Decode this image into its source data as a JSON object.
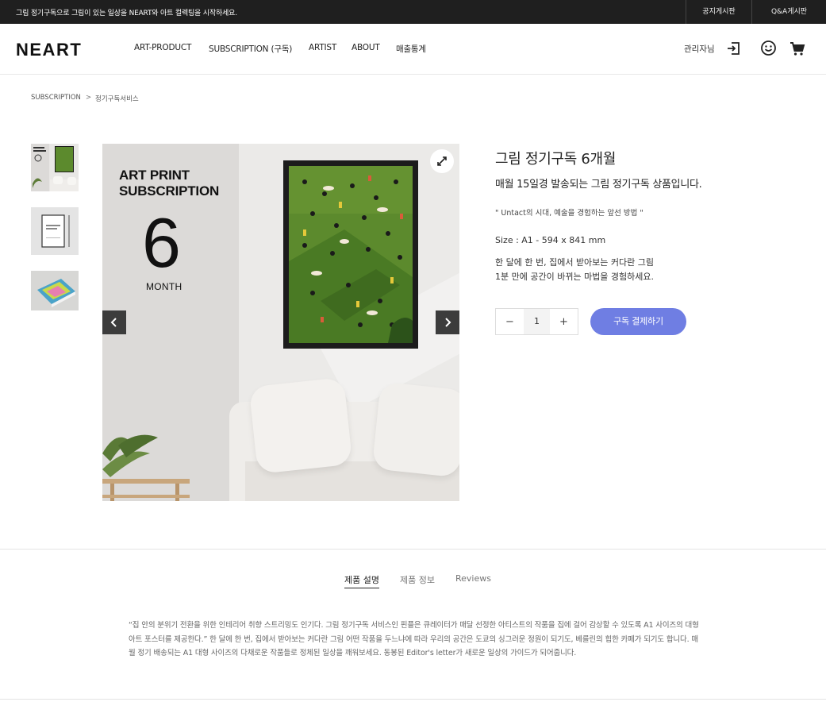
{
  "topbar": {
    "notice": "그림 정기구독으로 그림이 있는 일상을 NEART와 아트 컬렉팅을 시작하세요.",
    "links": [
      "공지게시판",
      "Q&A게시판"
    ]
  },
  "header": {
    "logo": "NEART",
    "nav": [
      "ART-PRODUCT",
      "SUBSCRIPTION (구독)",
      "ARTIST",
      "ABOUT",
      "매출통계"
    ],
    "admin": "관리자님"
  },
  "breadcrumb": {
    "items": [
      "SUBSCRIPTION",
      "정기구독서비스"
    ],
    "separator": ">"
  },
  "poster": {
    "title_line1": "ART PRINT",
    "title_line2": "SUBSCRIPTION",
    "number": "6",
    "unit": "MONTH"
  },
  "product": {
    "title": "그림 정기구독 6개월",
    "subtitle": "매월 15일경 발송되는 그림 정기구독 상품입니다.",
    "quote": "\" Untact의 시대, 예술을 경험하는 앞선 방법 \"",
    "size": "Size : A1 - 594 x 841 mm",
    "desc_line1": "한 달에 한 번, 집에서 받아보는 커다란 그림",
    "desc_line2": "1분 만에 공간이 바뀌는 마법을 경험하세요.",
    "qty_minus": "−",
    "qty_value": "1",
    "qty_plus": "+",
    "pay_button": "구독 결제하기"
  },
  "tabs": [
    "제품 설명",
    "제품 정보",
    "Reviews"
  ],
  "description": "“집 안의 분위기 전환을 위한 인테리어 취향 스트리밍도 인기다. 그림 정기구독 서비스인 핀플은 큐레이터가 매달 선정한 아티스트의 작품을 집에 걸어 감상할 수 있도록 A1 사이즈의 대형 아트 포스터를 제공한다.” 한 달에 한 번, 집에서 받아보는 커다란 그림 어떤 작품을 두느냐에 따라 우리의 공간은 도쿄의 싱그러운 정원이 되기도, 베를린의 힙한 카페가 되기도 합니다. 매월 정기 배송되는 A1 대형 사이즈의 다채로운 작품들로 정체된 일상을 깨워보세요. 동봉된 Editor's letter가 새로운 일상의 가이드가 되어줍니다.",
  "colors": {
    "topbar_bg": "#1f1f1f",
    "accent": "#6f7ee3",
    "art_green": "#5c8a2d"
  },
  "icons": [
    "login-icon",
    "smile-icon",
    "cart-icon",
    "expand-icon",
    "chevron-left-icon",
    "chevron-right-icon"
  ]
}
